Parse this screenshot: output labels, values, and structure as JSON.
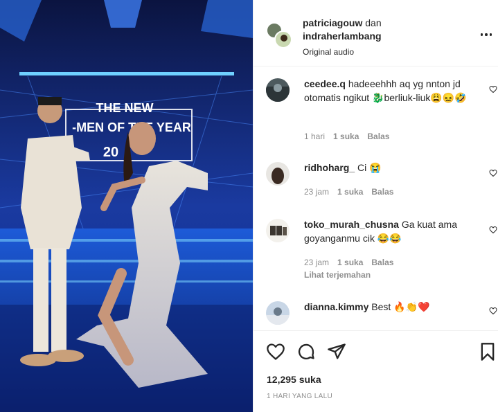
{
  "media": {
    "stage_text_line1": "THE NEW",
    "stage_text_line2": "-MEN OF THE YEAR",
    "stage_text_line3": "20"
  },
  "header": {
    "user1": "patriciagouw",
    "conjunction": "dan",
    "user2": "indraherlambang",
    "audio": "Original audio",
    "more_icon": "more-horizontal-icon"
  },
  "comments": [
    {
      "user": "ceedee.q",
      "text": "hadeeehhh aq yg nnton jd otomatis ngikut 🐉berliuk-liuk😩😖🤣",
      "time": "1 hari",
      "likes": "1 suka",
      "reply": "Balas"
    },
    {
      "user": "ridhoharg_",
      "text": "Ci 😭",
      "time": "23 jam",
      "likes": "1 suka",
      "reply": "Balas"
    },
    {
      "user": "toko_murah_chusna",
      "text": "Ga kuat ama goyanganmu cik 😂😂",
      "time": "23 jam",
      "likes": "1 suka",
      "reply": "Balas",
      "translate": "Lihat terjemahan"
    },
    {
      "user": "dianna.kimmy",
      "text": "Best 🔥👏❤️"
    }
  ],
  "actions": {
    "likes": "12,295 suka",
    "date": "1 HARI YANG LALU"
  },
  "colors": {
    "text": "#262626",
    "secondary": "#8e8e8e",
    "border": "#efefef"
  }
}
